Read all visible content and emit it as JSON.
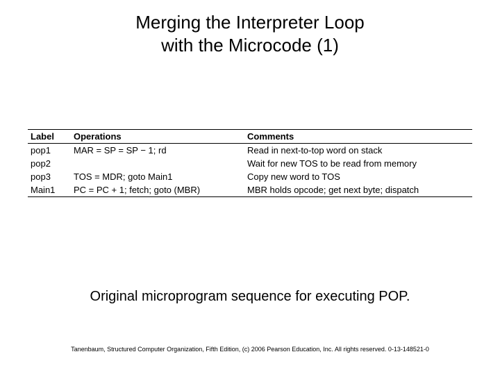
{
  "title": {
    "line1": "Merging the Interpreter Loop",
    "line2": "with the Microcode (1)"
  },
  "table": {
    "headers": {
      "label": "Label",
      "operations": "Operations",
      "comments": "Comments"
    },
    "rows": [
      {
        "label": "pop1",
        "operations": "MAR = SP = SP − 1; rd",
        "comments": "Read in next-to-top word on stack"
      },
      {
        "label": "pop2",
        "operations": "",
        "comments": "Wait for new TOS to be read from memory"
      },
      {
        "label": "pop3",
        "operations": "TOS = MDR; goto Main1",
        "comments": "Copy new word to TOS"
      },
      {
        "label": "Main1",
        "operations": "PC = PC + 1; fetch; goto (MBR)",
        "comments": "MBR holds opcode; get next byte; dispatch"
      }
    ]
  },
  "caption": "Original microprogram sequence for executing POP.",
  "footer": "Tanenbaum, Structured Computer Organization, Fifth Edition, (c) 2006 Pearson Education, Inc. All rights reserved. 0-13-148521-0"
}
